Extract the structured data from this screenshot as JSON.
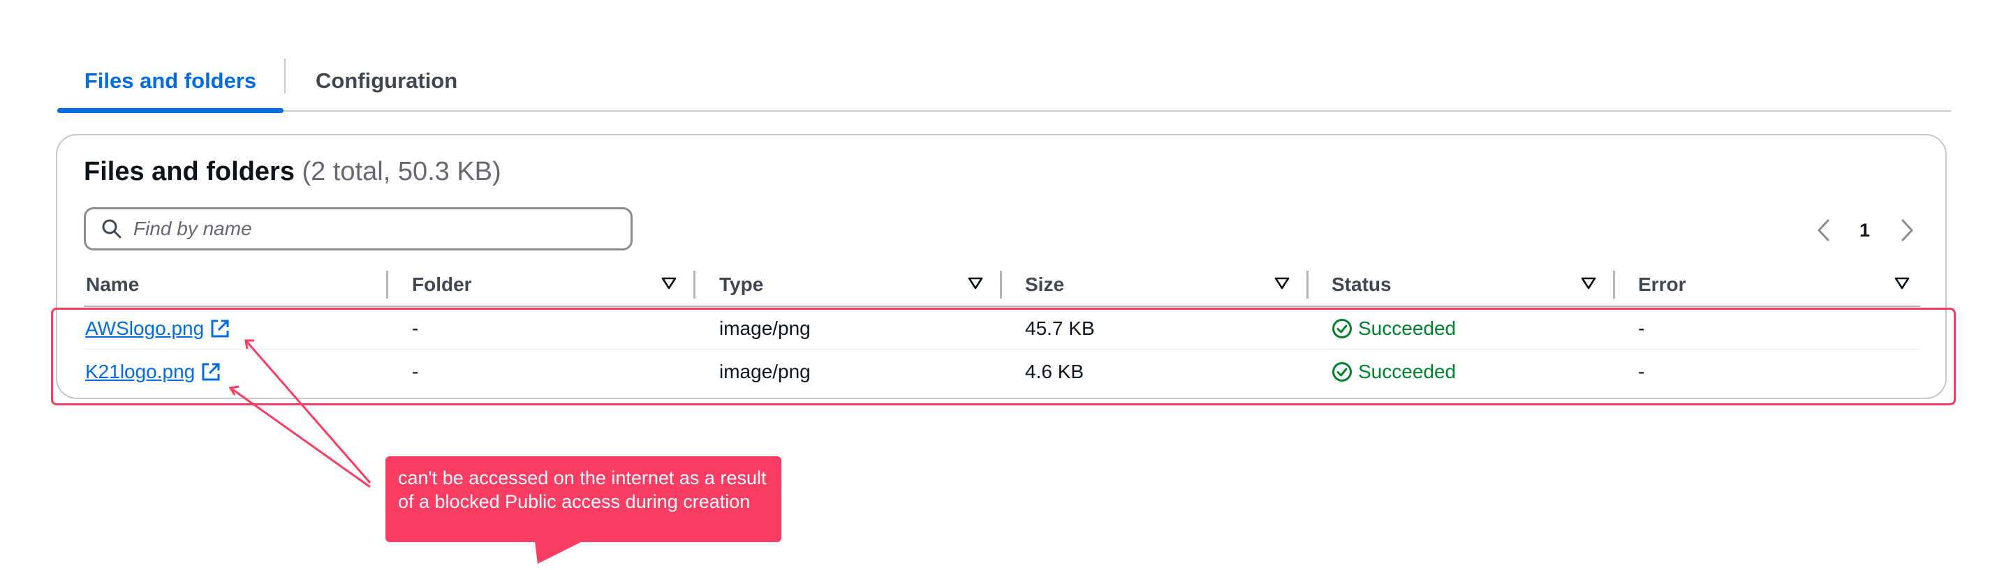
{
  "tabs": [
    {
      "label": "Files and folders",
      "active": true
    },
    {
      "label": "Configuration",
      "active": false
    }
  ],
  "panel": {
    "title": "Files and folders",
    "counter": "(2 total, 50.3 KB)"
  },
  "search": {
    "placeholder": "Find by name",
    "value": "",
    "icon": "search-icon"
  },
  "pagination": {
    "current_page": "1",
    "prev_icon": "chevron-left-icon",
    "next_icon": "chevron-right-icon"
  },
  "table": {
    "columns": [
      "Name",
      "Folder",
      "Type",
      "Size",
      "Status",
      "Error"
    ],
    "rows": [
      {
        "name": "AWSlogo.png",
        "folder": "-",
        "type": "image/png",
        "size": "45.7 KB",
        "status": "Succeeded",
        "error": "-"
      },
      {
        "name": "K21logo.png",
        "folder": "-",
        "type": "image/png",
        "size": "4.6 KB",
        "status": "Succeeded",
        "error": "-"
      }
    ]
  },
  "annotation": {
    "text": "can't be accessed on the internet as a result of a blocked Public access during creation"
  },
  "colors": {
    "accent": "#006ce0",
    "success": "#00802f",
    "annotation": "#fb3c63"
  }
}
